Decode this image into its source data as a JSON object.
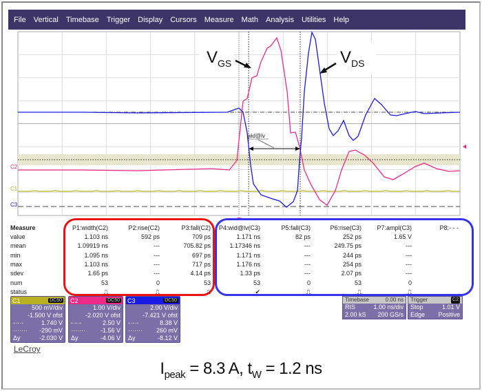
{
  "menu": [
    "File",
    "Vertical",
    "Timebase",
    "Trigger",
    "Display",
    "Cursors",
    "Measure",
    "Math",
    "Analysis",
    "Utilities",
    "Help"
  ],
  "annotations": {
    "vgs_main": "V",
    "vgs_sub": "GS",
    "vds_main": "V",
    "vds_sub": "DS",
    "measure_marker": "wid@lv"
  },
  "trace_labels": {
    "c1": "C1",
    "c2": "C2",
    "c3": "C3"
  },
  "colors": {
    "c1": "#b8b020",
    "c2": "#ee2a88",
    "c3": "#1a1ae6",
    "menu": "#3d3468",
    "panel": "#7a6fa6"
  },
  "measure": {
    "title": "Measure",
    "headers": [
      "P1:width(C2)",
      "P2:rise(C2)",
      "P3:fall(C2)",
      "P4:wid@lv(C3)",
      "P5:fall(C3)",
      "P6:rise(C3)",
      "P7:ampl(C3)",
      "P8:- - -"
    ],
    "rows": [
      {
        "label": "value",
        "cells": [
          "1.103 ns",
          "592 ps",
          "709 ps",
          "1.171 ns",
          "82 ps",
          "252 ps",
          "1.65 V",
          ""
        ]
      },
      {
        "label": "mean",
        "cells": [
          "1.09919 ns",
          "---",
          "705.82 ps",
          "1.17346 ns",
          "---",
          "249.75 ps",
          "---",
          ""
        ]
      },
      {
        "label": "min",
        "cells": [
          "1.095 ns",
          "---",
          "697 ps",
          "1.171 ns",
          "---",
          "244 ps",
          "---",
          ""
        ]
      },
      {
        "label": "max",
        "cells": [
          "1.103 ns",
          "---",
          "717 ps",
          "1.176 ns",
          "---",
          "254 ps",
          "---",
          ""
        ]
      },
      {
        "label": "sdev",
        "cells": [
          "1.65 ps",
          "---",
          "4.14 ps",
          "1.33 ps",
          "---",
          "2.07 ps",
          "---",
          ""
        ]
      },
      {
        "label": "num",
        "cells": [
          "53",
          "0",
          "53",
          "53",
          "0",
          "53",
          "0",
          ""
        ]
      },
      {
        "label": "status",
        "cells": [
          "⎍",
          "⎍",
          "⎍",
          "✔",
          "⎍",
          "⎍",
          "⎍",
          ""
        ]
      }
    ]
  },
  "channels": [
    {
      "name": "C1",
      "coupling": "DC50",
      "vdiv": "500 mV/div",
      "offset": "-1.500 V ofst",
      "dashdot": "1.740 V",
      "dotted": "-290 mV",
      "dy_label": "Δy",
      "dy": "-2.030 V"
    },
    {
      "name": "C2",
      "coupling": "DC50",
      "vdiv": "1.00 V/div",
      "offset": "-2.020 V ofst",
      "dashdot": "2.50 V",
      "dotted": "-1.56 V",
      "dy_label": "Δy",
      "dy": "-4.06 V"
    },
    {
      "name": "C3",
      "coupling": "DC50",
      "vdiv": "2.00 V/div",
      "offset": "-7.421 V ofst",
      "dashdot": "8.38 V",
      "dotted": "260 mV",
      "dy_label": "Δy",
      "dy": "-8.12 V"
    }
  ],
  "cursor_symbols": {
    "dashdot": "-·-·-",
    "dotted": "·······"
  },
  "timebase": {
    "title": "Timebase",
    "delay": "0.00 ns",
    "mode": "RIS",
    "tdiv": "1.00 ns/div",
    "samples": "2.00 kS",
    "rate": "200 GS/s"
  },
  "trigger": {
    "title": "Trigger",
    "source": "C2",
    "mode": "Stop",
    "level": "1.01 V",
    "type": "Edge",
    "slope": "Positive"
  },
  "logo": "LeCroy",
  "formula": {
    "i": "I",
    "i_sub": "peak",
    "i_rest": " = 8.3 A, t",
    "t_sub": "W",
    "t_rest": " = 1.2 ns"
  }
}
